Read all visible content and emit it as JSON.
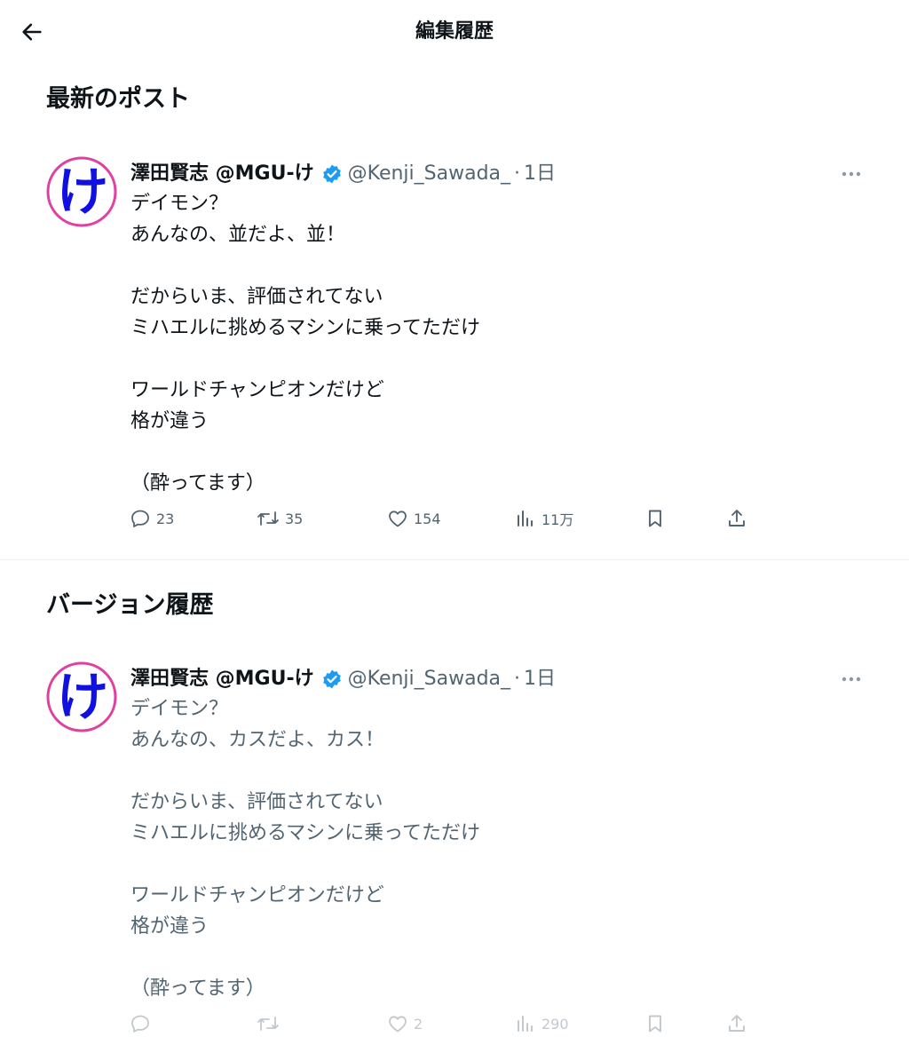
{
  "header": {
    "title": "編集履歴",
    "back_icon": "arrow-left-icon"
  },
  "latest_section": {
    "heading": "最新のポスト"
  },
  "history_section": {
    "heading": "バージョン履歴"
  },
  "latest_post": {
    "display_name": "澤田賢志 @MGU-け",
    "handle": "@Kenji_Sawada_",
    "separator": "·",
    "time": "1日",
    "avatar_char": "け",
    "lines": [
      "デイモン？",
      "あんなの、並だよ、並！",
      "",
      "だからいま、評価されてない",
      "ミハエルに挑めるマシンに乗ってただけ",
      "",
      "ワールドチャンピオンだけど",
      "格が違う",
      "",
      "（酔ってます）"
    ],
    "metrics": {
      "replies": "23",
      "reposts": "35",
      "likes": "154",
      "views": "11万"
    }
  },
  "previous_post": {
    "display_name": "澤田賢志 @MGU-け",
    "handle": "@Kenji_Sawada_",
    "separator": "·",
    "time": "1日",
    "avatar_char": "け",
    "lines": [
      "デイモン？",
      "あんなの、カスだよ、カス！",
      "",
      "だからいま、評価されてない",
      "ミハエルに挑めるマシンに乗ってただけ",
      "",
      "ワールドチャンピオンだけど",
      "格が違う",
      "",
      "（酔ってます）"
    ],
    "metrics": {
      "likes": "2",
      "views": "290"
    }
  },
  "colors": {
    "text_primary": "#0f1419",
    "text_secondary": "#536471",
    "verified": "#1d9bf0",
    "avatar_ring": "#e040a0",
    "avatar_glyph": "#1010e0",
    "divider": "#eff3f4"
  }
}
